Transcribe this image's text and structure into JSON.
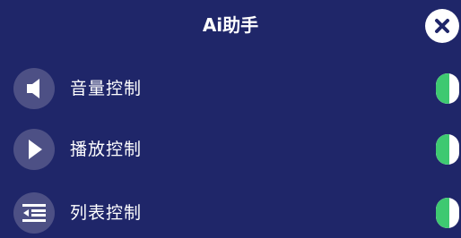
{
  "header": {
    "title": "Ai助手"
  },
  "close_icon": "close-icon",
  "items": [
    {
      "label": "音量控制",
      "icon": "speaker-icon",
      "enabled": true
    },
    {
      "label": "播放控制",
      "icon": "play-icon",
      "enabled": true
    },
    {
      "label": "列表控制",
      "icon": "list-icon",
      "enabled": true
    }
  ],
  "colors": {
    "background": "#1f2669",
    "icon_circle": "#4d5085",
    "toggle_on": "#3ec971",
    "text": "#ffffff"
  }
}
